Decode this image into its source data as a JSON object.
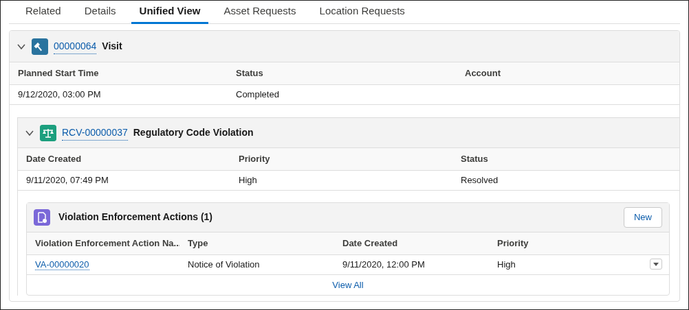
{
  "tabs": [
    {
      "label": "Related",
      "selected": false
    },
    {
      "label": "Details",
      "selected": false
    },
    {
      "label": "Unified View",
      "selected": true
    },
    {
      "label": "Asset Requests",
      "selected": false
    },
    {
      "label": "Location Requests",
      "selected": false
    }
  ],
  "visit": {
    "expanded": true,
    "number": "00000064",
    "type": "Visit",
    "columns": [
      "Planned Start Time",
      "Status",
      "Account"
    ],
    "values": [
      "9/12/2020, 03:00 PM",
      "Completed"
    ]
  },
  "violation": {
    "expanded": true,
    "number": "RCV-00000037",
    "type": "Regulatory Code Violation",
    "columns": [
      "Date Created",
      "Priority",
      "Status"
    ],
    "values": [
      "9/11/2020, 07:49 PM",
      "High",
      "Resolved"
    ]
  },
  "related_list": {
    "title": "Violation Enforcement Actions (1)",
    "new_button": "New",
    "columns": [
      "Violation Enforcement Action Na...",
      "Type",
      "Date Created",
      "Priority"
    ],
    "rows": [
      {
        "cells": [
          "VA-00000020",
          "Notice of Violation",
          "9/11/2020, 12:00 PM",
          "High"
        ]
      }
    ],
    "view_all": "View All"
  }
}
